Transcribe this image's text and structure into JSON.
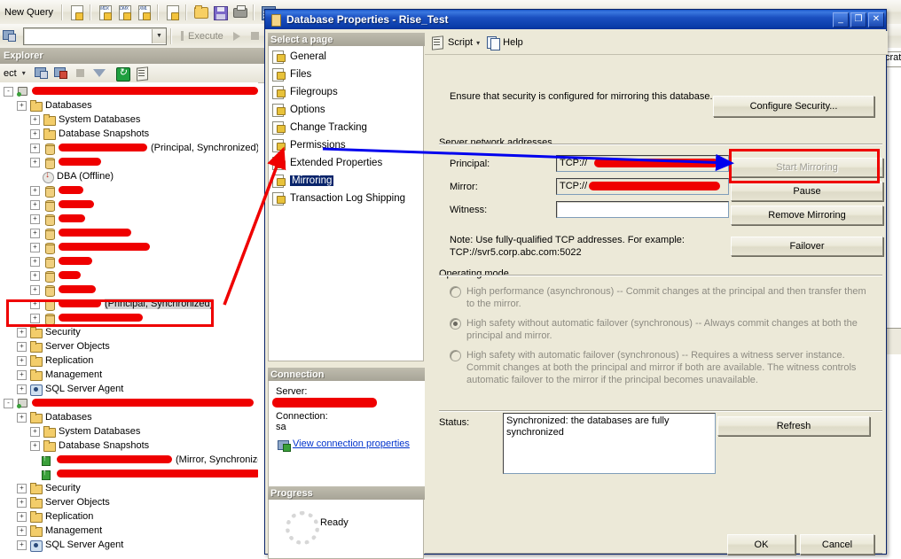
{
  "app": {
    "toolbar_top": {
      "new_query": "New Query",
      "icons": [
        "new-document-icon",
        "mdx-query-icon",
        "dmx-query-icon",
        "xmla-query-icon",
        "new-file-icon",
        "open-file-icon",
        "save-icon",
        "print-icon",
        "design-query-icon"
      ]
    },
    "toolbar_second": {
      "database_combo_value": "",
      "execute_label": "Execute",
      "icons": [
        "change-connection-icon",
        "parse-icon",
        "execute-play-icon",
        "stop-icon"
      ]
    },
    "object_explorer": {
      "title": "Explorer",
      "toolbar": {
        "connect_label": "ect",
        "icons": [
          "connect-icon",
          "disconnect-icon",
          "stop-icon",
          "filter-icon",
          "refresh-icon",
          "script-icon"
        ]
      },
      "tree": [
        {
          "indent": 0,
          "expander": "-",
          "icon": "server-icon",
          "label": "",
          "redacted": 255,
          "selected": false
        },
        {
          "indent": 1,
          "expander": "+",
          "icon": "folder-icon",
          "label": "Databases",
          "redacted": 0,
          "selected": false
        },
        {
          "indent": 2,
          "expander": "+",
          "icon": "folder-icon",
          "label": "System Databases",
          "redacted": 0,
          "selected": false
        },
        {
          "indent": 2,
          "expander": "+",
          "icon": "folder-icon",
          "label": "Database Snapshots",
          "redacted": 0,
          "selected": false
        },
        {
          "indent": 2,
          "expander": "+",
          "icon": "database-icon",
          "label": "(Principal, Synchronized)",
          "redacted": 100,
          "selected": false
        },
        {
          "indent": 2,
          "expander": "+",
          "icon": "database-icon",
          "label": "",
          "redacted": 48,
          "selected": false
        },
        {
          "indent": 2,
          "expander": "",
          "icon": "database-offline-icon",
          "label": "DBA (Offline)",
          "redacted": 0,
          "selected": false
        },
        {
          "indent": 2,
          "expander": "+",
          "icon": "database-icon",
          "label": "",
          "redacted": 28,
          "selected": false
        },
        {
          "indent": 2,
          "expander": "+",
          "icon": "database-icon",
          "label": "",
          "redacted": 40,
          "selected": false
        },
        {
          "indent": 2,
          "expander": "+",
          "icon": "database-icon",
          "label": "",
          "redacted": 30,
          "selected": false
        },
        {
          "indent": 2,
          "expander": "+",
          "icon": "database-icon",
          "label": "",
          "redacted": 82,
          "selected": false
        },
        {
          "indent": 2,
          "expander": "+",
          "icon": "database-icon",
          "label": "",
          "redacted": 103,
          "selected": false
        },
        {
          "indent": 2,
          "expander": "+",
          "icon": "database-icon",
          "label": "",
          "redacted": 38,
          "selected": false
        },
        {
          "indent": 2,
          "expander": "+",
          "icon": "database-icon",
          "label": "",
          "redacted": 25,
          "selected": false
        },
        {
          "indent": 2,
          "expander": "+",
          "icon": "database-icon",
          "label": "",
          "redacted": 42,
          "selected": false
        },
        {
          "indent": 2,
          "expander": "+",
          "icon": "database-icon",
          "label": "(Principal, Synchronized)",
          "redacted": 48,
          "selected": true
        },
        {
          "indent": 2,
          "expander": "+",
          "icon": "database-icon",
          "label": "",
          "redacted": 95,
          "selected": false
        },
        {
          "indent": 1,
          "expander": "+",
          "icon": "folder-icon",
          "label": "Security",
          "redacted": 0,
          "selected": false
        },
        {
          "indent": 1,
          "expander": "+",
          "icon": "folder-icon",
          "label": "Server Objects",
          "redacted": 0,
          "selected": false
        },
        {
          "indent": 1,
          "expander": "+",
          "icon": "folder-icon",
          "label": "Replication",
          "redacted": 0,
          "selected": false
        },
        {
          "indent": 1,
          "expander": "+",
          "icon": "folder-icon",
          "label": "Management",
          "redacted": 0,
          "selected": false
        },
        {
          "indent": 1,
          "expander": "+",
          "icon": "agent-icon",
          "label": "SQL Server Agent",
          "redacted": 0,
          "selected": false
        },
        {
          "indent": 0,
          "expander": "-",
          "icon": "server-icon",
          "label": "",
          "redacted": 250,
          "selected": false
        },
        {
          "indent": 1,
          "expander": "+",
          "icon": "folder-icon",
          "label": "Databases",
          "redacted": 0,
          "selected": false
        },
        {
          "indent": 2,
          "expander": "+",
          "icon": "folder-icon",
          "label": "System Databases",
          "redacted": 0,
          "selected": false
        },
        {
          "indent": 2,
          "expander": "+",
          "icon": "folder-icon",
          "label": "Database Snapshots",
          "redacted": 0,
          "selected": false
        },
        {
          "indent": 2,
          "expander": "",
          "icon": "mirror-db-icon",
          "label": "(Mirror, Synchronized) / Restor",
          "redacted": 130,
          "selected": false
        },
        {
          "indent": 2,
          "expander": "",
          "icon": "mirror-db-icon",
          "label": "",
          "redacted": 230,
          "selected": false
        },
        {
          "indent": 1,
          "expander": "+",
          "icon": "folder-icon",
          "label": "Security",
          "redacted": 0,
          "selected": false
        },
        {
          "indent": 1,
          "expander": "+",
          "icon": "folder-icon",
          "label": "Server Objects",
          "redacted": 0,
          "selected": false
        },
        {
          "indent": 1,
          "expander": "+",
          "icon": "folder-icon",
          "label": "Replication",
          "redacted": 0,
          "selected": false
        },
        {
          "indent": 1,
          "expander": "+",
          "icon": "folder-icon",
          "label": "Management",
          "redacted": 0,
          "selected": false
        },
        {
          "indent": 1,
          "expander": "+",
          "icon": "agent-icon",
          "label": "SQL Server Agent",
          "redacted": 0,
          "selected": false
        }
      ]
    },
    "background_tab_label": "crat"
  },
  "dialog": {
    "title": "Database Properties - Rise_Test",
    "window_buttons": {
      "minimize": "_",
      "maximize": "❐",
      "close": "✕"
    },
    "toolbar": {
      "script_label": "Script",
      "help_label": "Help",
      "dropdown_caret": "▾"
    },
    "select_page": {
      "header": "Select a page",
      "items": [
        {
          "label": "General",
          "selected": false
        },
        {
          "label": "Files",
          "selected": false
        },
        {
          "label": "Filegroups",
          "selected": false
        },
        {
          "label": "Options",
          "selected": false
        },
        {
          "label": "Change Tracking",
          "selected": false
        },
        {
          "label": "Permissions",
          "selected": false
        },
        {
          "label": "Extended Properties",
          "selected": false
        },
        {
          "label": "Mirroring",
          "selected": true
        },
        {
          "label": "Transaction Log Shipping",
          "selected": false
        }
      ]
    },
    "connection": {
      "header": "Connection",
      "server_label": "Server:",
      "server_value": "",
      "connection_label": "Connection:",
      "connection_value": "sa",
      "view_properties_link": "View connection properties"
    },
    "progress": {
      "header": "Progress",
      "status": "Ready"
    },
    "security": {
      "note": "Ensure that security is configured for mirroring this database.",
      "configure_button": "Configure Security..."
    },
    "server_network_addresses": {
      "group_label": "Server network addresses",
      "principal_label": "Principal:",
      "principal_value": "TCP://",
      "mirror_label": "Mirror:",
      "mirror_value": "TCP://",
      "witness_label": "Witness:",
      "witness_value": "",
      "note_line1": "Note: Use fully-qualified TCP addresses. For example:",
      "note_line2": "TCP://svr5.corp.abc.com:5022"
    },
    "action_buttons": {
      "start_mirroring": "Start Mirroring",
      "pause": "Pause",
      "remove_mirroring": "Remove Mirroring",
      "failover": "Failover"
    },
    "operating_mode": {
      "group_label": "Operating mode",
      "options": [
        {
          "selected": false,
          "text": "High performance (asynchronous) -- Commit changes at the principal and then transfer them to the mirror."
        },
        {
          "selected": true,
          "text": "High safety without automatic failover (synchronous) -- Always commit changes at both the principal and mirror."
        },
        {
          "selected": false,
          "text": "High safety with automatic failover (synchronous) -- Requires a witness server instance. Commit changes at both the principal and mirror if both are available. The witness controls automatic failover to the mirror if the principal becomes unavailable."
        }
      ]
    },
    "status": {
      "label": "Status:",
      "value": "Synchronized: the databases are fully synchronized",
      "refresh_button": "Refresh"
    },
    "footer": {
      "ok": "OK",
      "cancel": "Cancel"
    }
  },
  "annotations": {
    "redaction_color": "#ef0000",
    "highlight_box_color": "#ef0000",
    "arrow_red_color": "#ef0000",
    "arrow_blue_color": "#0000ee"
  }
}
